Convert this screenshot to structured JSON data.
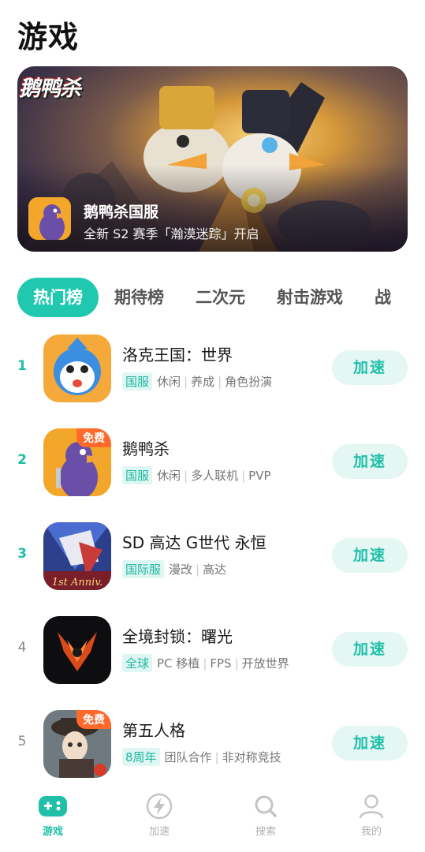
{
  "header": {
    "title": "游戏"
  },
  "banner": {
    "logo_text": "鹅鸭杀",
    "game_title": "鹅鸭杀国服",
    "subtitle": "全新 S2 赛季「瀚漠迷踪」开启"
  },
  "tabs": [
    {
      "label": "热门榜",
      "active": true
    },
    {
      "label": "期待榜",
      "active": false
    },
    {
      "label": "二次元",
      "active": false
    },
    {
      "label": "射击游戏",
      "active": false
    },
    {
      "label": "战",
      "active": false
    }
  ],
  "games": [
    {
      "rank": "1",
      "name": "洛克王国：世界",
      "badge": "国服",
      "tags": [
        "休闲",
        "养成",
        "角色扮演"
      ],
      "action": "加速",
      "free": ""
    },
    {
      "rank": "2",
      "name": "鹅鸭杀",
      "badge": "国服",
      "tags": [
        "休闲",
        "多人联机",
        "PVP"
      ],
      "action": "加速",
      "free": "免费"
    },
    {
      "rank": "3",
      "name": "SD 高达 G世代 永恒",
      "badge": "国际服",
      "tags": [
        "漫改",
        "高达"
      ],
      "action": "加速",
      "free": "",
      "icon_text": "1st Anniv."
    },
    {
      "rank": "4",
      "name": "全境封锁：曙光",
      "badge": "全球",
      "tags": [
        "PC 移植",
        "FPS",
        "开放世界"
      ],
      "action": "加速",
      "free": ""
    },
    {
      "rank": "5",
      "name": "第五人格",
      "badge": "8周年",
      "tags": [
        "团队合作",
        "非对称竞技"
      ],
      "action": "加速",
      "free": "免费"
    }
  ],
  "bottom_nav": [
    {
      "label": "游戏",
      "icon": "gamepad-icon",
      "active": true
    },
    {
      "label": "加速",
      "icon": "lightning-icon",
      "active": false
    },
    {
      "label": "搜索",
      "icon": "search-icon",
      "active": false
    },
    {
      "label": "我的",
      "icon": "user-icon",
      "active": false
    }
  ],
  "colors": {
    "accent": "#1fbfa8",
    "tab_active_bg": "#20c8b0",
    "free_tag": "#ff6a2c"
  }
}
